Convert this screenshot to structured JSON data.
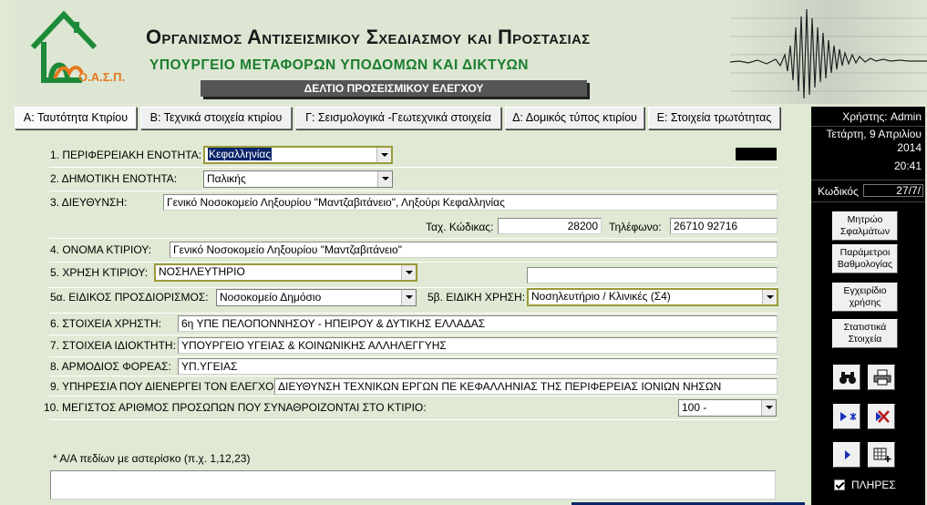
{
  "header": {
    "logo_text": "Ο.Α.Σ.Π.",
    "org_title": "Οργανισμος Αντισεισμικου Σχεδιασμου και Προστασιας",
    "ministry": "ΥΠΟΥΡΓΕΙΟ ΜΕΤΑΦΟΡΩΝ ΥΠΟΔΟΜΩΝ ΚΑΙ ΔΙΚΤΥΩΝ",
    "form_title": "ΔΕΛΤΙΟ ΠΡΟΣΕΙΣΜΙΚΟΥ ΕΛΕΓΧΟΥ"
  },
  "tabs": [
    {
      "label": "Α: Ταυτότητα Κτιρίου",
      "active": true
    },
    {
      "label": "Β: Τεχνικά στοιχεία κτιρίου",
      "active": false
    },
    {
      "label": "Γ: Σεισμολογικά -Γεωτεχνικά στοιχεία",
      "active": false
    },
    {
      "label": "Δ: Δομικός τύπος κτιρίου",
      "active": false
    },
    {
      "label": "Ε: Στοιχεία τρωτότητας",
      "active": false
    }
  ],
  "form": {
    "f1": {
      "label": "1. ΠΕΡΙΦΕΡΕΙΑΚΗ ΕΝΟΤΗΤΑ:",
      "value": "Κεφαλληνίας"
    },
    "f2": {
      "label": "2. ΔΗΜΟΤΙΚΗ ΕΝΟΤΗΤΑ:",
      "value": "Παλικής"
    },
    "f3": {
      "label": "3. ΔΙΕΥΘΥΝΣΗ:",
      "value": "Γενικό Νοσοκομείο Ληξουρίου \"Μαντζαβιτάνειο\", Ληξούρι Κεφαλληνίας"
    },
    "postal": {
      "label": "Ταχ. Κώδικας:",
      "value": "28200"
    },
    "phone": {
      "label": "Τηλέφωνο:",
      "value": "26710 92716"
    },
    "f4": {
      "label": "4. ΟΝΟΜΑ ΚΤΙΡΙΟΥ:",
      "value": "Γενικό Νοσοκομείο Ληξουρίου \"Μαντζαβιτάνειο\""
    },
    "f5": {
      "label": "5. ΧΡΗΣΗ ΚΤΙΡΙΟΥ:",
      "value": "ΝΟΣΗΛΕΥΤΗΡΙΟ",
      "extra": ""
    },
    "f5a": {
      "label": "5α. ΕΙΔΙΚΟΣ ΠΡΟΣΔΙΟΡΙΣΜΟΣ:",
      "value": "Νοσοκομείο Δημόσιο"
    },
    "f5b": {
      "label": "5β. ΕΙΔΙΚΗ ΧΡΗΣΗ:",
      "value": "Νοσηλευτήριο / Κλινικές (Σ4)"
    },
    "f6": {
      "label": "6. ΣΤΟΙΧΕΙΑ ΧΡΗΣΤΗ:",
      "value": "6η ΥΠΕ ΠΕΛΟΠΟΝΝΗΣΟΥ - ΗΠΕΙΡΟΥ & ΔΥΤΙΚΗΣ ΕΛΛΑΔΑΣ"
    },
    "f7": {
      "label": "7. ΣΤΟΙΧΕΙΑ ΙΔΙΟΚΤΗΤΗ:",
      "value": "ΥΠΟΥΡΓΕΙΟ ΥΓΕΙΑΣ & ΚΟΙΝΩΝΙΚΗΣ ΑΛΛΗΛΕΓΓΥΗΣ"
    },
    "f8": {
      "label": "8. ΑΡΜΟΔΙΟΣ ΦΟΡΕΑΣ:",
      "value": "ΥΠ.ΥΓΕΙΑΣ"
    },
    "f9": {
      "label": "9. ΥΠΗΡΕΣΙΑ ΠΟΥ ΔΙΕΝΕΡΓΕΙ ΤΟΝ ΕΛΕΓΧΟ:",
      "value": "ΔΙΕΥΘΥΝΣΗ ΤΕΧΝΙΚΩΝ ΕΡΓΩΝ ΠΕ ΚΕΦΑΛΛΗΝΙΑΣ ΤΗΣ ΠΕΡΙΦΕΡΕΙΑΣ ΙΟΝΙΩΝ ΝΗΣΩΝ"
    },
    "f10": {
      "label": "10. ΜΕΓΙΣΤΟΣ ΑΡΙΘΜΟΣ ΠΡΟΣΩΠΩΝ ΠΟΥ ΣΥΝΑΘΡΟΙΖΟΝΤΑΙ ΣΤΟ ΚΤΙΡΙΟ:",
      "value": "100 -"
    },
    "note": "* Α/Α πεδίων με αστερίσκο (π.χ. 1,12,23)",
    "notes_value": ""
  },
  "panel": {
    "user": "Χρήστης: Admin",
    "date_line1": "Τετάρτη, 9 Απριλίου",
    "date_line2": "2014",
    "time": "20:41",
    "code_label": "Κωδικός",
    "code_value": "27/7/",
    "btn_registry": "Μητρώο Σφαλμάτων",
    "btn_params": "Παράμετροι Βαθμολογίας",
    "btn_manual": "Εγχειρίδιο χρήσης",
    "btn_stats": "Στατιστικά Στοιχεία",
    "complete_label": "ΠΛΗΡΕΣ",
    "complete_checked": true
  },
  "colors": {
    "background": "#dfe9d3",
    "ministry_green": "#1a7d2e",
    "logo_orange": "#e7781f",
    "logo_green": "#1d8a3a",
    "panel_bg": "#000000",
    "selection": "#0a246a"
  },
  "icons": [
    "binoculars-icon",
    "printer-icon",
    "new-record-icon",
    "delete-record-icon",
    "next-record-icon",
    "add-record-icon"
  ]
}
